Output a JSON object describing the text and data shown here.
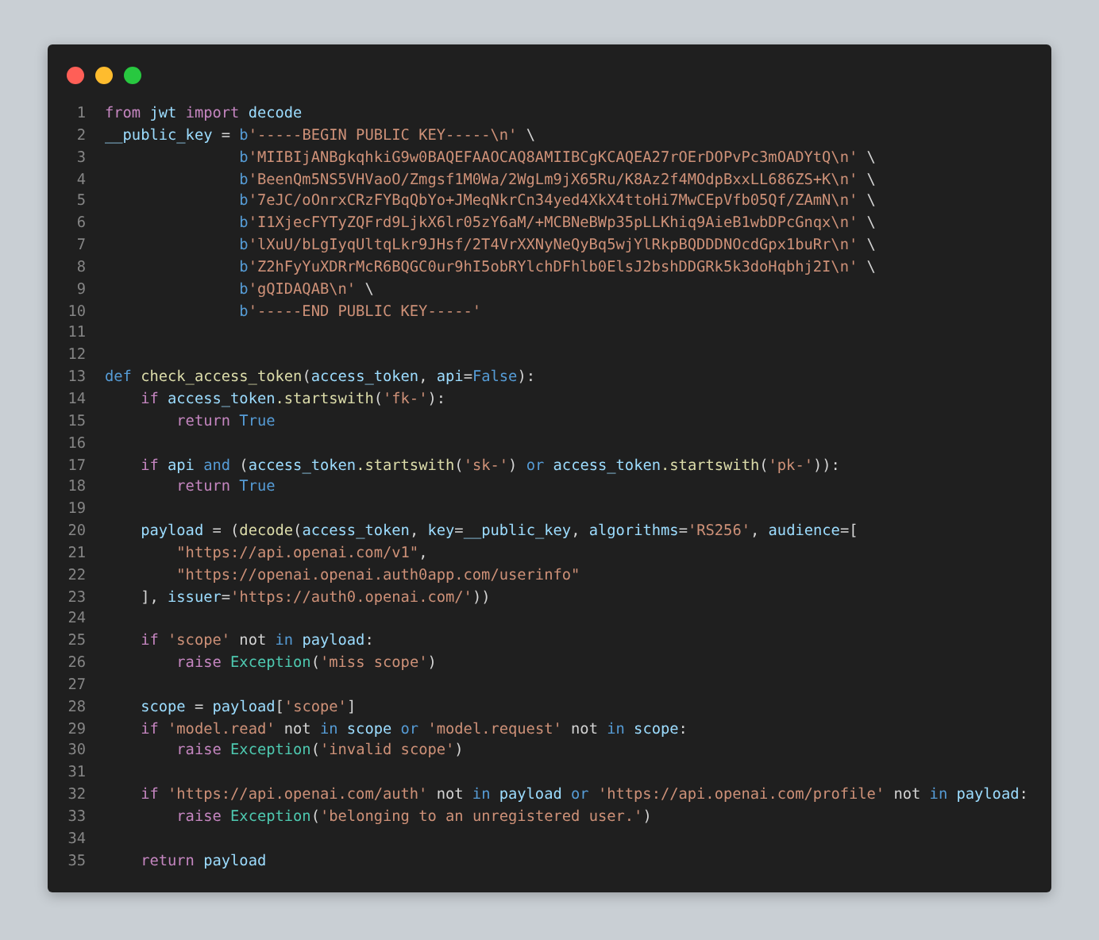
{
  "window": {
    "controls": [
      {
        "kind": "close"
      },
      {
        "kind": "minimize"
      },
      {
        "kind": "maximize"
      }
    ]
  },
  "code": {
    "lines": [
      {
        "number": "1",
        "tokens": [
          {
            "kind": "kw",
            "text": "from "
          },
          {
            "kind": "var",
            "text": "jwt "
          },
          {
            "kind": "kw",
            "text": "import "
          },
          {
            "kind": "var",
            "text": "decode"
          }
        ]
      },
      {
        "number": "2",
        "tokens": [
          {
            "kind": "var",
            "text": "__public_key "
          },
          {
            "kind": "plain",
            "text": "= "
          },
          {
            "kind": "kw2",
            "text": "b"
          },
          {
            "kind": "str",
            "text": "'-----BEGIN PUBLIC KEY-----\\n' "
          },
          {
            "kind": "plain",
            "text": "\\"
          }
        ]
      },
      {
        "number": "3",
        "tokens": [
          {
            "kind": "kw2",
            "text": "               b"
          },
          {
            "kind": "str",
            "text": "'MIIBIjANBgkqhkiG9w0BAQEFAAOCAQ8AMIIBCgKCAQEA27rOErDOPvPc3mOADYtQ\\n' "
          },
          {
            "kind": "plain",
            "text": "\\"
          }
        ]
      },
      {
        "number": "4",
        "tokens": [
          {
            "kind": "kw2",
            "text": "               b"
          },
          {
            "kind": "str",
            "text": "'BeenQm5NS5VHVaoO/Zmgsf1M0Wa/2WgLm9jX65Ru/K8Az2f4MOdpBxxLL686ZS+K\\n' "
          },
          {
            "kind": "plain",
            "text": "\\"
          }
        ]
      },
      {
        "number": "5",
        "tokens": [
          {
            "kind": "kw2",
            "text": "               b"
          },
          {
            "kind": "str",
            "text": "'7eJC/oOnrxCRzFYBqQbYo+JMeqNkrCn34yed4XkX4ttoHi7MwCEpVfb05Qf/ZAmN\\n' "
          },
          {
            "kind": "plain",
            "text": "\\"
          }
        ]
      },
      {
        "number": "6",
        "tokens": [
          {
            "kind": "kw2",
            "text": "               b"
          },
          {
            "kind": "str",
            "text": "'I1XjecFYTyZQFrd9LjkX6lr05zY6aM/+MCBNeBWp35pLLKhiq9AieB1wbDPcGnqx\\n' "
          },
          {
            "kind": "plain",
            "text": "\\"
          }
        ]
      },
      {
        "number": "7",
        "tokens": [
          {
            "kind": "kw2",
            "text": "               b"
          },
          {
            "kind": "str",
            "text": "'lXuU/bLgIyqUltqLkr9JHsf/2T4VrXXNyNeQyBq5wjYlRkpBQDDDNOcdGpx1buRr\\n' "
          },
          {
            "kind": "plain",
            "text": "\\"
          }
        ]
      },
      {
        "number": "8",
        "tokens": [
          {
            "kind": "kw2",
            "text": "               b"
          },
          {
            "kind": "str",
            "text": "'Z2hFyYuXDRrMcR6BQGC0ur9hI5obRYlchDFhlb0ElsJ2bshDDGRk5k3doHqbhj2I\\n' "
          },
          {
            "kind": "plain",
            "text": "\\"
          }
        ]
      },
      {
        "number": "9",
        "tokens": [
          {
            "kind": "kw2",
            "text": "               b"
          },
          {
            "kind": "str",
            "text": "'gQIDAQAB\\n' "
          },
          {
            "kind": "plain",
            "text": "\\"
          }
        ]
      },
      {
        "number": "10",
        "tokens": [
          {
            "kind": "kw2",
            "text": "               b"
          },
          {
            "kind": "str",
            "text": "'-----END PUBLIC KEY-----'"
          }
        ]
      },
      {
        "number": "11"
      },
      {
        "number": "12"
      },
      {
        "number": "13",
        "tokens": [
          {
            "kind": "kw2",
            "text": "def "
          },
          {
            "kind": "func",
            "text": "check_access_token"
          },
          {
            "kind": "plain",
            "text": "("
          },
          {
            "kind": "var",
            "text": "access_token"
          },
          {
            "kind": "plain",
            "text": ", "
          },
          {
            "kind": "var",
            "text": "api"
          },
          {
            "kind": "plain",
            "text": "="
          },
          {
            "kind": "kw2",
            "text": "False"
          },
          {
            "kind": "plain",
            "text": "):"
          }
        ]
      },
      {
        "number": "14",
        "tokens": [
          {
            "kind": "kw",
            "text": "    if "
          },
          {
            "kind": "var",
            "text": "access_token"
          },
          {
            "kind": "func",
            "text": ".startswith"
          },
          {
            "kind": "plain",
            "text": "("
          },
          {
            "kind": "str",
            "text": "'fk-'"
          },
          {
            "kind": "plain",
            "text": "):"
          }
        ]
      },
      {
        "number": "15",
        "tokens": [
          {
            "kind": "kw",
            "text": "        return "
          },
          {
            "kind": "kw2",
            "text": "True"
          }
        ]
      },
      {
        "number": "16"
      },
      {
        "number": "17",
        "tokens": [
          {
            "kind": "kw",
            "text": "    if "
          },
          {
            "kind": "var",
            "text": "api "
          },
          {
            "kind": "kw2",
            "text": "and "
          },
          {
            "kind": "plain",
            "text": "("
          },
          {
            "kind": "var",
            "text": "access_token"
          },
          {
            "kind": "func",
            "text": ".startswith"
          },
          {
            "kind": "plain",
            "text": "("
          },
          {
            "kind": "str",
            "text": "'sk-'"
          },
          {
            "kind": "plain",
            "text": ") "
          },
          {
            "kind": "kw2",
            "text": "or "
          },
          {
            "kind": "var",
            "text": "access_token"
          },
          {
            "kind": "func",
            "text": ".startswith"
          },
          {
            "kind": "plain",
            "text": "("
          },
          {
            "kind": "str",
            "text": "'pk-'"
          },
          {
            "kind": "plain",
            "text": ")):"
          }
        ]
      },
      {
        "number": "18",
        "tokens": [
          {
            "kind": "kw",
            "text": "        return "
          },
          {
            "kind": "kw2",
            "text": "True"
          }
        ]
      },
      {
        "number": "19"
      },
      {
        "number": "20",
        "tokens": [
          {
            "kind": "var",
            "text": "    payload "
          },
          {
            "kind": "plain",
            "text": "= ("
          },
          {
            "kind": "func",
            "text": "decode"
          },
          {
            "kind": "plain",
            "text": "("
          },
          {
            "kind": "var",
            "text": "access_token"
          },
          {
            "kind": "plain",
            "text": ", "
          },
          {
            "kind": "var",
            "text": "key"
          },
          {
            "kind": "plain",
            "text": "="
          },
          {
            "kind": "var",
            "text": "__public_key"
          },
          {
            "kind": "plain",
            "text": ", "
          },
          {
            "kind": "var",
            "text": "algorithms"
          },
          {
            "kind": "plain",
            "text": "="
          },
          {
            "kind": "str",
            "text": "'RS256'"
          },
          {
            "kind": "plain",
            "text": ", "
          },
          {
            "kind": "var",
            "text": "audience"
          },
          {
            "kind": "plain",
            "text": "=["
          }
        ]
      },
      {
        "number": "21",
        "tokens": [
          {
            "kind": "str",
            "text": "        \"https://api.openai.com/v1\""
          },
          {
            "kind": "plain",
            "text": ","
          }
        ]
      },
      {
        "number": "22",
        "tokens": [
          {
            "kind": "str",
            "text": "        \"https://openai.openai.auth0app.com/userinfo\""
          }
        ]
      },
      {
        "number": "23",
        "tokens": [
          {
            "kind": "plain",
            "text": "    ], "
          },
          {
            "kind": "var",
            "text": "issuer"
          },
          {
            "kind": "plain",
            "text": "="
          },
          {
            "kind": "str",
            "text": "'https://auth0.openai.com/'"
          },
          {
            "kind": "plain",
            "text": "))"
          }
        ]
      },
      {
        "number": "24"
      },
      {
        "number": "25",
        "tokens": [
          {
            "kind": "kw",
            "text": "    if "
          },
          {
            "kind": "str",
            "text": "'scope' "
          },
          {
            "kind": "op",
            "text": "not "
          },
          {
            "kind": "kw2",
            "text": "in "
          },
          {
            "kind": "var",
            "text": "payload"
          },
          {
            "kind": "plain",
            "text": ":"
          }
        ]
      },
      {
        "number": "26",
        "tokens": [
          {
            "kind": "kw",
            "text": "        raise "
          },
          {
            "kind": "cls",
            "text": "Exception"
          },
          {
            "kind": "plain",
            "text": "("
          },
          {
            "kind": "str",
            "text": "'miss scope'"
          },
          {
            "kind": "plain",
            "text": ")"
          }
        ]
      },
      {
        "number": "27"
      },
      {
        "number": "28",
        "tokens": [
          {
            "kind": "var",
            "text": "    scope "
          },
          {
            "kind": "plain",
            "text": "= "
          },
          {
            "kind": "var",
            "text": "payload"
          },
          {
            "kind": "plain",
            "text": "["
          },
          {
            "kind": "str",
            "text": "'scope'"
          },
          {
            "kind": "plain",
            "text": "]"
          }
        ]
      },
      {
        "number": "29",
        "tokens": [
          {
            "kind": "kw",
            "text": "    if "
          },
          {
            "kind": "str",
            "text": "'model.read' "
          },
          {
            "kind": "op",
            "text": "not "
          },
          {
            "kind": "kw2",
            "text": "in "
          },
          {
            "kind": "var",
            "text": "scope "
          },
          {
            "kind": "kw2",
            "text": "or "
          },
          {
            "kind": "str",
            "text": "'model.request' "
          },
          {
            "kind": "op",
            "text": "not "
          },
          {
            "kind": "kw2",
            "text": "in "
          },
          {
            "kind": "var",
            "text": "scope"
          },
          {
            "kind": "plain",
            "text": ":"
          }
        ]
      },
      {
        "number": "30",
        "tokens": [
          {
            "kind": "kw",
            "text": "        raise "
          },
          {
            "kind": "cls",
            "text": "Exception"
          },
          {
            "kind": "plain",
            "text": "("
          },
          {
            "kind": "str",
            "text": "'invalid scope'"
          },
          {
            "kind": "plain",
            "text": ")"
          }
        ]
      },
      {
        "number": "31"
      },
      {
        "number": "32",
        "tokens": [
          {
            "kind": "kw",
            "text": "    if "
          },
          {
            "kind": "str",
            "text": "'https://api.openai.com/auth' "
          },
          {
            "kind": "op",
            "text": "not "
          },
          {
            "kind": "kw2",
            "text": "in "
          },
          {
            "kind": "var",
            "text": "payload "
          },
          {
            "kind": "kw2",
            "text": "or "
          },
          {
            "kind": "str",
            "text": "'https://api.openai.com/profile' "
          },
          {
            "kind": "op",
            "text": "not "
          },
          {
            "kind": "kw2",
            "text": "in "
          },
          {
            "kind": "var",
            "text": "payload"
          },
          {
            "kind": "plain",
            "text": ":"
          }
        ]
      },
      {
        "number": "33",
        "tokens": [
          {
            "kind": "kw",
            "text": "        raise "
          },
          {
            "kind": "cls",
            "text": "Exception"
          },
          {
            "kind": "plain",
            "text": "("
          },
          {
            "kind": "str",
            "text": "'belonging to an unregistered user.'"
          },
          {
            "kind": "plain",
            "text": ")"
          }
        ]
      },
      {
        "number": "34"
      },
      {
        "number": "35",
        "tokens": [
          {
            "kind": "kw",
            "text": "    return "
          },
          {
            "kind": "var",
            "text": "payload"
          }
        ]
      }
    ]
  }
}
